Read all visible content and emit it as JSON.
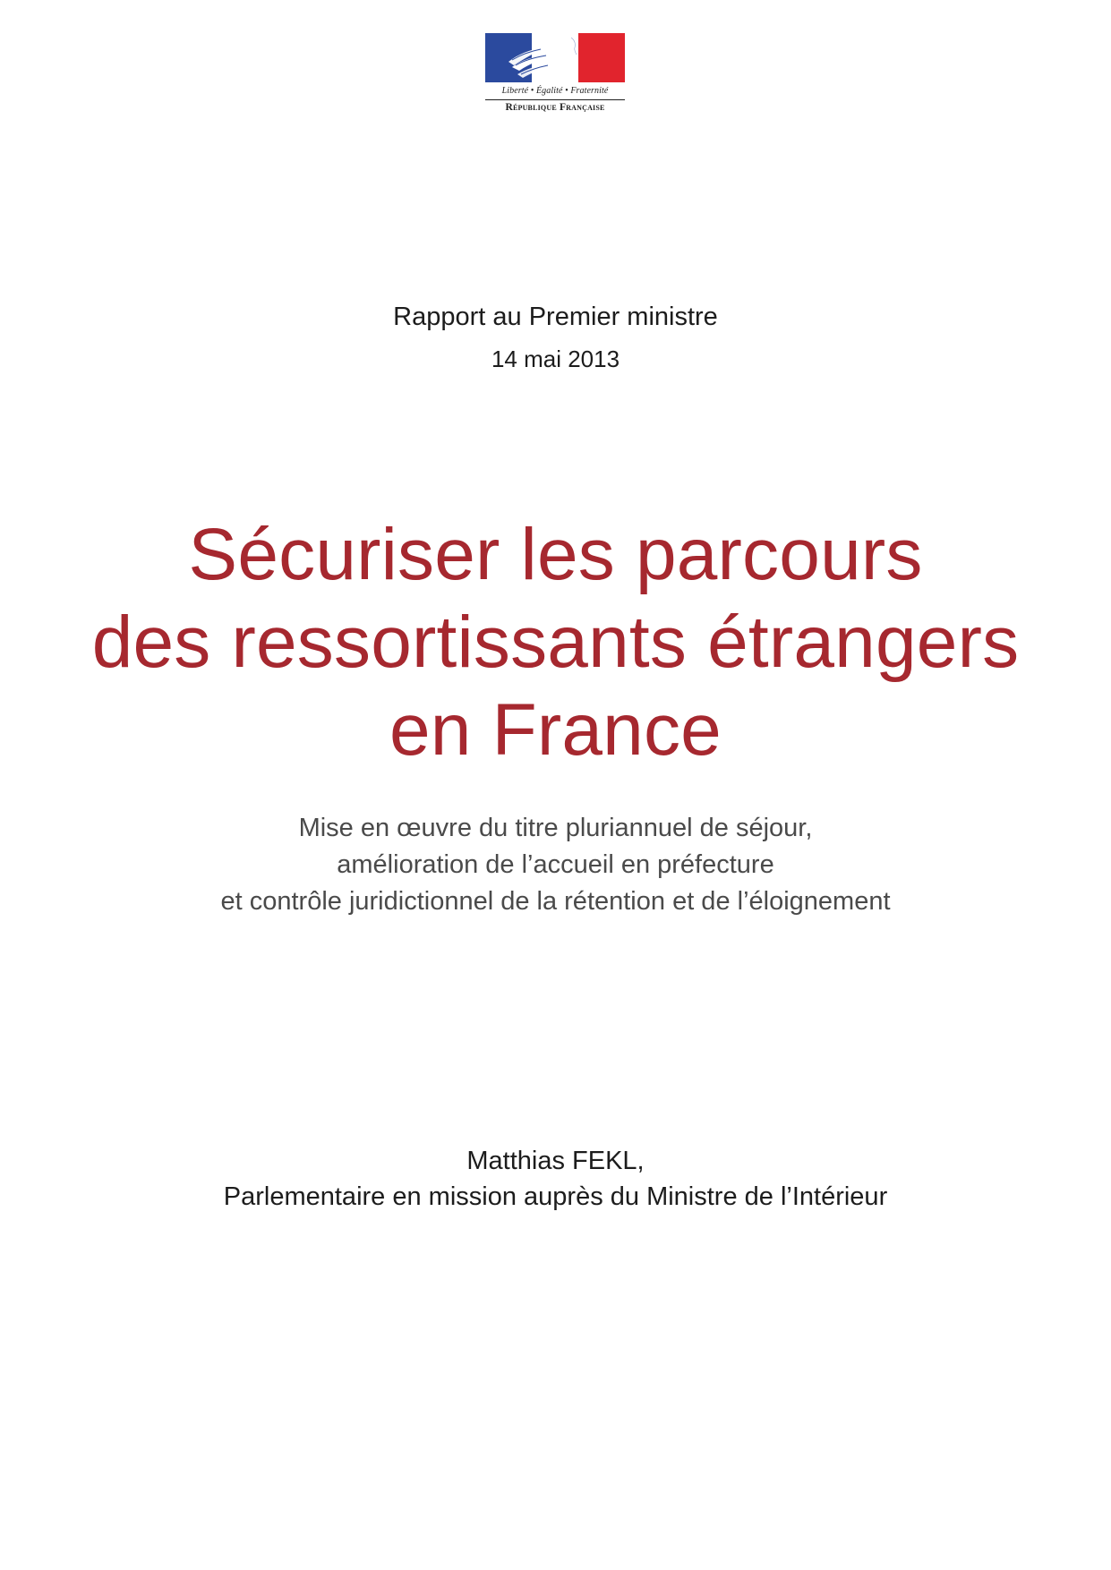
{
  "logo": {
    "motto": "Liberté • Égalité • Fraternité",
    "republic": "République Française",
    "colors": {
      "blue": "#2b4a9e",
      "white": "#ffffff",
      "red": "#e1242d"
    }
  },
  "header": {
    "report_for": "Rapport au Premier ministre",
    "date": "14 mai 2013"
  },
  "title": {
    "lines": [
      "Sécuriser les parcours",
      "des ressortissants étrangers",
      "en France"
    ],
    "color": "#a6282f"
  },
  "subtitle": {
    "lines": [
      "Mise en œuvre du titre pluriannuel de séjour,",
      "amélioration de l’accueil en préfecture",
      "et contrôle juridictionnel de la rétention et de l’éloignement"
    ]
  },
  "author": {
    "name": "Matthias FEKL,",
    "role": "Parlementaire en mission auprès du Ministre de l’Intérieur"
  }
}
